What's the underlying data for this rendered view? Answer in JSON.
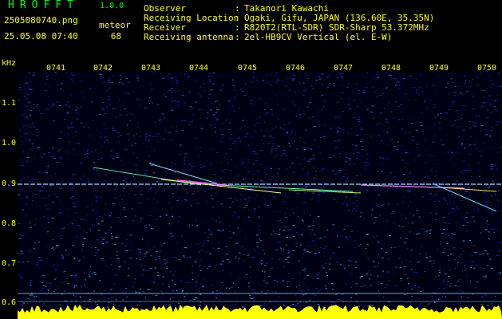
{
  "app": {
    "title": "HROFFT",
    "version": "1.0.0"
  },
  "file_name": "2505080740.png",
  "timestamp": "25.05.08 07:40",
  "meteor": {
    "label": "meteor",
    "count": "68"
  },
  "info": [
    {
      "label": "Observer",
      "value": "Takanori Kawachi"
    },
    {
      "label": "Receiving Location",
      "value": "Ogaki, Gifu, JAPAN (136.60E, 35.35N)"
    },
    {
      "label": "Receiver",
      "value": "R820T2(RTL-SDR) SDR-Sharp 53.372MHz"
    },
    {
      "label": "Receiving antenna",
      "value": "2el-HB9CV Vertical (el. E-W)"
    }
  ],
  "axis": {
    "y_unit": "kHz",
    "y_ticks": [
      "1.1",
      "1.0",
      "0.9",
      "0.8",
      "0.7",
      "0.6"
    ],
    "x_ticks": [
      "0741",
      "0742",
      "0743",
      "0744",
      "0745",
      "0746",
      "0747",
      "0748",
      "0749",
      "0750"
    ]
  },
  "colors": {
    "background": "#000000",
    "noise": "#1a2a9a",
    "title": "#00ff00",
    "text": "#ffff00",
    "echo": "#ff40ff"
  },
  "chart_data": {
    "type": "heatmap",
    "ylabel": "kHz",
    "x_ticks": [
      "0741",
      "0742",
      "0743",
      "0744",
      "0745",
      "0746",
      "0747",
      "0748",
      "0749",
      "0750"
    ],
    "y_ticks": [
      1.1,
      1.0,
      0.9,
      0.8,
      0.7,
      0.6
    ],
    "ylim": [
      0.57,
      1.17
    ],
    "carrier_khz": 0.893
  }
}
